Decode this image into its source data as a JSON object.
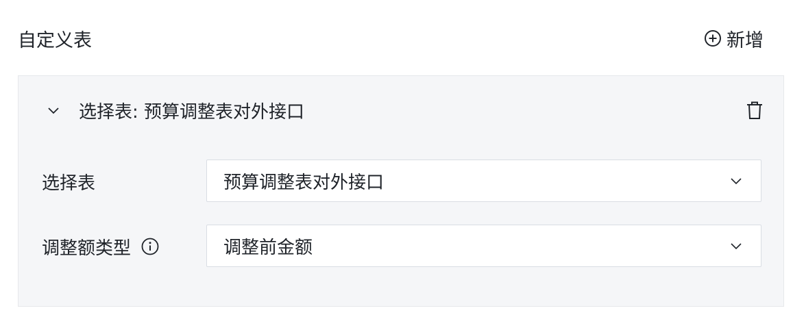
{
  "header": {
    "title": "自定义表",
    "add_label": "新增"
  },
  "panel": {
    "title": "选择表: 预算调整表对外接口",
    "fields": [
      {
        "label": "选择表",
        "value": "预算调整表对外接口"
      },
      {
        "label": "调整额类型",
        "value": "调整前金额"
      }
    ]
  },
  "colors": {
    "text": "#1f2329",
    "panel_bg": "#f5f6f8",
    "border": "#d9dde3"
  }
}
